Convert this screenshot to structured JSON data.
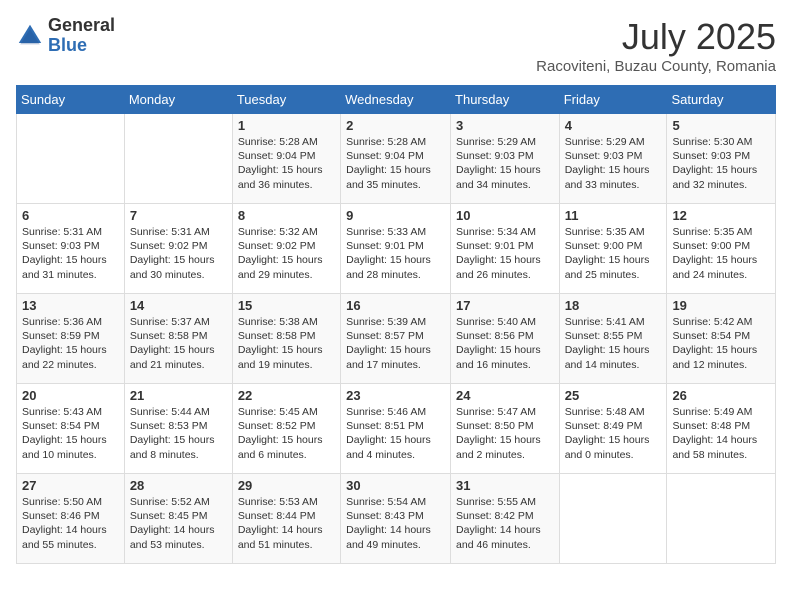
{
  "header": {
    "logo_general": "General",
    "logo_blue": "Blue",
    "month_title": "July 2025",
    "location": "Racoviteni, Buzau County, Romania"
  },
  "weekdays": [
    "Sunday",
    "Monday",
    "Tuesday",
    "Wednesday",
    "Thursday",
    "Friday",
    "Saturday"
  ],
  "weeks": [
    [
      {
        "day": "",
        "info": ""
      },
      {
        "day": "",
        "info": ""
      },
      {
        "day": "1",
        "info": "Sunrise: 5:28 AM\nSunset: 9:04 PM\nDaylight: 15 hours and 36 minutes."
      },
      {
        "day": "2",
        "info": "Sunrise: 5:28 AM\nSunset: 9:04 PM\nDaylight: 15 hours and 35 minutes."
      },
      {
        "day": "3",
        "info": "Sunrise: 5:29 AM\nSunset: 9:03 PM\nDaylight: 15 hours and 34 minutes."
      },
      {
        "day": "4",
        "info": "Sunrise: 5:29 AM\nSunset: 9:03 PM\nDaylight: 15 hours and 33 minutes."
      },
      {
        "day": "5",
        "info": "Sunrise: 5:30 AM\nSunset: 9:03 PM\nDaylight: 15 hours and 32 minutes."
      }
    ],
    [
      {
        "day": "6",
        "info": "Sunrise: 5:31 AM\nSunset: 9:03 PM\nDaylight: 15 hours and 31 minutes."
      },
      {
        "day": "7",
        "info": "Sunrise: 5:31 AM\nSunset: 9:02 PM\nDaylight: 15 hours and 30 minutes."
      },
      {
        "day": "8",
        "info": "Sunrise: 5:32 AM\nSunset: 9:02 PM\nDaylight: 15 hours and 29 minutes."
      },
      {
        "day": "9",
        "info": "Sunrise: 5:33 AM\nSunset: 9:01 PM\nDaylight: 15 hours and 28 minutes."
      },
      {
        "day": "10",
        "info": "Sunrise: 5:34 AM\nSunset: 9:01 PM\nDaylight: 15 hours and 26 minutes."
      },
      {
        "day": "11",
        "info": "Sunrise: 5:35 AM\nSunset: 9:00 PM\nDaylight: 15 hours and 25 minutes."
      },
      {
        "day": "12",
        "info": "Sunrise: 5:35 AM\nSunset: 9:00 PM\nDaylight: 15 hours and 24 minutes."
      }
    ],
    [
      {
        "day": "13",
        "info": "Sunrise: 5:36 AM\nSunset: 8:59 PM\nDaylight: 15 hours and 22 minutes."
      },
      {
        "day": "14",
        "info": "Sunrise: 5:37 AM\nSunset: 8:58 PM\nDaylight: 15 hours and 21 minutes."
      },
      {
        "day": "15",
        "info": "Sunrise: 5:38 AM\nSunset: 8:58 PM\nDaylight: 15 hours and 19 minutes."
      },
      {
        "day": "16",
        "info": "Sunrise: 5:39 AM\nSunset: 8:57 PM\nDaylight: 15 hours and 17 minutes."
      },
      {
        "day": "17",
        "info": "Sunrise: 5:40 AM\nSunset: 8:56 PM\nDaylight: 15 hours and 16 minutes."
      },
      {
        "day": "18",
        "info": "Sunrise: 5:41 AM\nSunset: 8:55 PM\nDaylight: 15 hours and 14 minutes."
      },
      {
        "day": "19",
        "info": "Sunrise: 5:42 AM\nSunset: 8:54 PM\nDaylight: 15 hours and 12 minutes."
      }
    ],
    [
      {
        "day": "20",
        "info": "Sunrise: 5:43 AM\nSunset: 8:54 PM\nDaylight: 15 hours and 10 minutes."
      },
      {
        "day": "21",
        "info": "Sunrise: 5:44 AM\nSunset: 8:53 PM\nDaylight: 15 hours and 8 minutes."
      },
      {
        "day": "22",
        "info": "Sunrise: 5:45 AM\nSunset: 8:52 PM\nDaylight: 15 hours and 6 minutes."
      },
      {
        "day": "23",
        "info": "Sunrise: 5:46 AM\nSunset: 8:51 PM\nDaylight: 15 hours and 4 minutes."
      },
      {
        "day": "24",
        "info": "Sunrise: 5:47 AM\nSunset: 8:50 PM\nDaylight: 15 hours and 2 minutes."
      },
      {
        "day": "25",
        "info": "Sunrise: 5:48 AM\nSunset: 8:49 PM\nDaylight: 15 hours and 0 minutes."
      },
      {
        "day": "26",
        "info": "Sunrise: 5:49 AM\nSunset: 8:48 PM\nDaylight: 14 hours and 58 minutes."
      }
    ],
    [
      {
        "day": "27",
        "info": "Sunrise: 5:50 AM\nSunset: 8:46 PM\nDaylight: 14 hours and 55 minutes."
      },
      {
        "day": "28",
        "info": "Sunrise: 5:52 AM\nSunset: 8:45 PM\nDaylight: 14 hours and 53 minutes."
      },
      {
        "day": "29",
        "info": "Sunrise: 5:53 AM\nSunset: 8:44 PM\nDaylight: 14 hours and 51 minutes."
      },
      {
        "day": "30",
        "info": "Sunrise: 5:54 AM\nSunset: 8:43 PM\nDaylight: 14 hours and 49 minutes."
      },
      {
        "day": "31",
        "info": "Sunrise: 5:55 AM\nSunset: 8:42 PM\nDaylight: 14 hours and 46 minutes."
      },
      {
        "day": "",
        "info": ""
      },
      {
        "day": "",
        "info": ""
      }
    ]
  ]
}
